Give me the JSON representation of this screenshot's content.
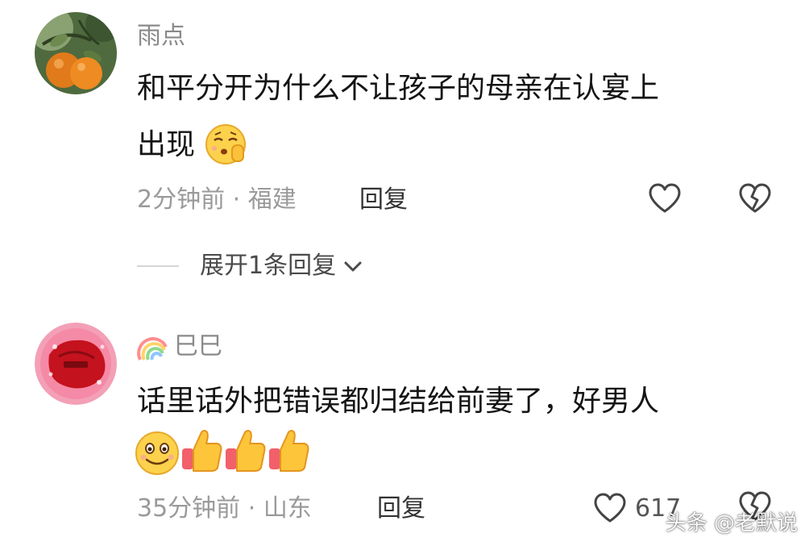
{
  "comments": [
    {
      "username": "雨点",
      "text_line1": "和平分开为什么不让孩子的母亲在认宴上",
      "text_line2": "出现",
      "time": "2分钟前",
      "location": "福建",
      "reply_label": "回复",
      "expand_label": "展开1条回复",
      "avatar_icon": "orange-fruit-avatar",
      "emoji_icon": "shushing-face-emoji"
    },
    {
      "username": "巳巳",
      "text_line1": "话里话外把错误都归结给前妻了，好男人",
      "time": "35分钟前",
      "location": "山东",
      "reply_label": "回复",
      "like_count": "617",
      "avatar_icon": "red-pink-badge-avatar",
      "name_badge_icon": "rainbow-icon",
      "emoji_icons": [
        "smile-face-emoji",
        "thumbs-up-emoji",
        "thumbs-up-emoji",
        "thumbs-up-emoji"
      ]
    }
  ],
  "meta_separator": "·",
  "watermark": "头条 @老默说",
  "colors": {
    "body_text": "#141414",
    "meta_text": "#9a9a9a",
    "username": "#8a8a8a"
  }
}
